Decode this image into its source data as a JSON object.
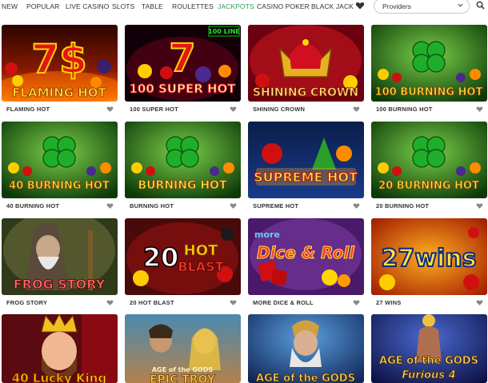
{
  "nav": {
    "items": [
      "NEW",
      "POPULAR",
      "LIVE CASINO",
      "SLOTS",
      "TABLE",
      "ROULETTES",
      "JACKPOTS",
      "CASINO POKER",
      "BLACK JACK"
    ],
    "active": "JACKPOTS",
    "favorites_icon": "heart-icon",
    "providers_label": "Providers",
    "providers_icon": "chevron-down-icon",
    "search_icon": "search-icon"
  },
  "colors": {
    "accent": "#2e9e57",
    "text": "#333333",
    "heart": "#888888"
  },
  "games": [
    {
      "name": "FLAMING HOT",
      "logo": "FLAMING HOT",
      "overlay": "7$"
    },
    {
      "name": "100 SUPER HOT",
      "logo": "100 SUPER HOT",
      "overlay": "7",
      "badge": "100 LINE"
    },
    {
      "name": "SHINING CROWN",
      "logo": "SHINING CROWN",
      "overlay": ""
    },
    {
      "name": "100 BURNING HOT",
      "logo": "100 BURNING HOT",
      "overlay": ""
    },
    {
      "name": "40 BURNING HOT",
      "logo": "40 BURNING HOT",
      "overlay": ""
    },
    {
      "name": "BURNING HOT",
      "logo": "BURNING HOT",
      "overlay": ""
    },
    {
      "name": "SUPREME HOT",
      "logo": "SUPREME HOT",
      "overlay": ""
    },
    {
      "name": "20 BURNING HOT",
      "logo": "20 BURNING HOT",
      "overlay": ""
    },
    {
      "name": "FROG STORY",
      "logo": "FROG STORY",
      "overlay": ""
    },
    {
      "name": "20 HOT BLAST",
      "logo": "BLAST",
      "overlay": "20",
      "logo_top": "HOT"
    },
    {
      "name": "MORE DICE & ROLL",
      "logo": "Dice & Roll",
      "overlay": "more"
    },
    {
      "name": "27 WINS",
      "logo": "27wins",
      "overlay": ""
    },
    {
      "name": "",
      "logo": "40 Lucky King",
      "overlay": ""
    },
    {
      "name": "",
      "logo": "EPIC TROY",
      "overlay": "AGE of the GODS"
    },
    {
      "name": "",
      "logo": "AGE of the GODS",
      "overlay": ""
    },
    {
      "name": "",
      "logo": "AGE of the GODS",
      "overlay": "Furious 4"
    }
  ]
}
